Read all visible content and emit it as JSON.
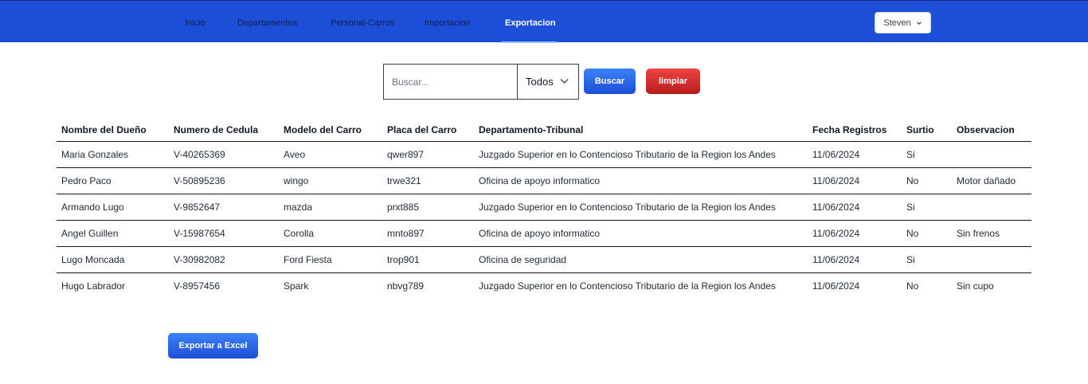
{
  "nav": {
    "items": [
      {
        "label": "Inicio",
        "active": false
      },
      {
        "label": "Departamentos",
        "active": false
      },
      {
        "label": "Personal-Carros",
        "active": false
      },
      {
        "label": "Importacion",
        "active": false
      },
      {
        "label": "Exportacion",
        "active": true
      }
    ],
    "user": "Steven",
    "user_icon": "chevron-down-icon"
  },
  "search": {
    "placeholder": "Buscar...",
    "value": "",
    "filter_value": "Todos",
    "search_label": "Buscar",
    "clear_label": "limpiar"
  },
  "table": {
    "headers": [
      "Nombre del Dueño",
      "Numero de Cedula",
      "Modelo del Carro",
      "Placa del Carro",
      "Departamento-Tribunal",
      "Fecha Registros",
      "Surtio",
      "Observacion"
    ],
    "rows": [
      [
        "Maria Gonzales",
        "V-40265369",
        "Aveo",
        "qwer897",
        "Juzgado Superior en lo Contencioso Tributario de la Region los Andes",
        "11/06/2024",
        "Si",
        ""
      ],
      [
        "Pedro Paco",
        "V-50895236",
        "wingo",
        "trwe321",
        "Oficina de apoyo informatico",
        "11/06/2024",
        "No",
        "Motor dañado"
      ],
      [
        "Armando Lugo",
        "V-9852647",
        "mazda",
        "prxt885",
        "Juzgado Superior en lo Contencioso Tributario de la Region los Andes",
        "11/06/2024",
        "Si",
        ""
      ],
      [
        "Angel Guillen",
        "V-15987654",
        "Corolla",
        "mnto897",
        "Oficina de apoyo informatico",
        "11/06/2024",
        "No",
        "Sin frenos"
      ],
      [
        "Lugo Moncada",
        "V-30982082",
        "Ford Fiesta",
        "trop901",
        "Oficina de seguridad",
        "11/06/2024",
        "Si",
        ""
      ],
      [
        "Hugo Labrador",
        "V-8957456",
        "Spark",
        "nbvg789",
        "Juzgado Superior en lo Contencioso Tributario de la Region los Andes",
        "11/06/2024",
        "No",
        "Sin cupo"
      ]
    ]
  },
  "export": {
    "label": "Exportar a Excel"
  },
  "colors": {
    "navbar": "#1d4ed8",
    "primary": "#2563eb",
    "danger": "#dc2626"
  }
}
